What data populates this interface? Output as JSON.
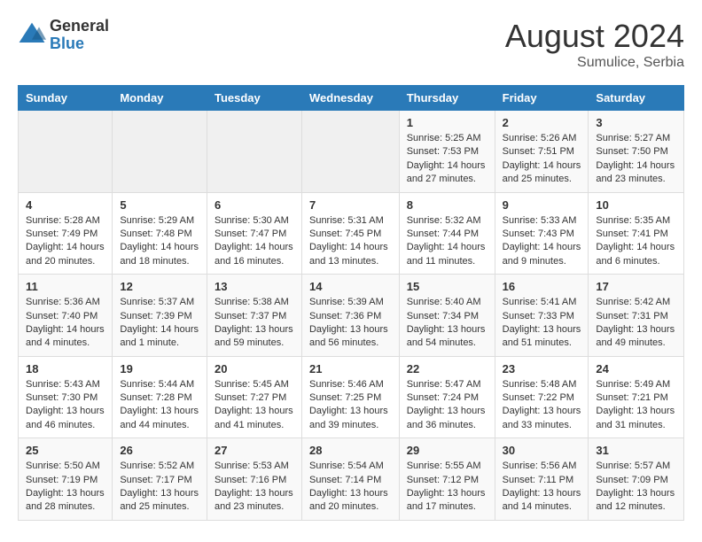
{
  "header": {
    "logo_general": "General",
    "logo_blue": "Blue",
    "month_year": "August 2024",
    "location": "Sumulice, Serbia"
  },
  "days_of_week": [
    "Sunday",
    "Monday",
    "Tuesday",
    "Wednesday",
    "Thursday",
    "Friday",
    "Saturday"
  ],
  "weeks": [
    [
      {
        "day": "",
        "content": ""
      },
      {
        "day": "",
        "content": ""
      },
      {
        "day": "",
        "content": ""
      },
      {
        "day": "",
        "content": ""
      },
      {
        "day": "1",
        "content": "Sunrise: 5:25 AM\nSunset: 7:53 PM\nDaylight: 14 hours and 27 minutes."
      },
      {
        "day": "2",
        "content": "Sunrise: 5:26 AM\nSunset: 7:51 PM\nDaylight: 14 hours and 25 minutes."
      },
      {
        "day": "3",
        "content": "Sunrise: 5:27 AM\nSunset: 7:50 PM\nDaylight: 14 hours and 23 minutes."
      }
    ],
    [
      {
        "day": "4",
        "content": "Sunrise: 5:28 AM\nSunset: 7:49 PM\nDaylight: 14 hours and 20 minutes."
      },
      {
        "day": "5",
        "content": "Sunrise: 5:29 AM\nSunset: 7:48 PM\nDaylight: 14 hours and 18 minutes."
      },
      {
        "day": "6",
        "content": "Sunrise: 5:30 AM\nSunset: 7:47 PM\nDaylight: 14 hours and 16 minutes."
      },
      {
        "day": "7",
        "content": "Sunrise: 5:31 AM\nSunset: 7:45 PM\nDaylight: 14 hours and 13 minutes."
      },
      {
        "day": "8",
        "content": "Sunrise: 5:32 AM\nSunset: 7:44 PM\nDaylight: 14 hours and 11 minutes."
      },
      {
        "day": "9",
        "content": "Sunrise: 5:33 AM\nSunset: 7:43 PM\nDaylight: 14 hours and 9 minutes."
      },
      {
        "day": "10",
        "content": "Sunrise: 5:35 AM\nSunset: 7:41 PM\nDaylight: 14 hours and 6 minutes."
      }
    ],
    [
      {
        "day": "11",
        "content": "Sunrise: 5:36 AM\nSunset: 7:40 PM\nDaylight: 14 hours and 4 minutes."
      },
      {
        "day": "12",
        "content": "Sunrise: 5:37 AM\nSunset: 7:39 PM\nDaylight: 14 hours and 1 minute."
      },
      {
        "day": "13",
        "content": "Sunrise: 5:38 AM\nSunset: 7:37 PM\nDaylight: 13 hours and 59 minutes."
      },
      {
        "day": "14",
        "content": "Sunrise: 5:39 AM\nSunset: 7:36 PM\nDaylight: 13 hours and 56 minutes."
      },
      {
        "day": "15",
        "content": "Sunrise: 5:40 AM\nSunset: 7:34 PM\nDaylight: 13 hours and 54 minutes."
      },
      {
        "day": "16",
        "content": "Sunrise: 5:41 AM\nSunset: 7:33 PM\nDaylight: 13 hours and 51 minutes."
      },
      {
        "day": "17",
        "content": "Sunrise: 5:42 AM\nSunset: 7:31 PM\nDaylight: 13 hours and 49 minutes."
      }
    ],
    [
      {
        "day": "18",
        "content": "Sunrise: 5:43 AM\nSunset: 7:30 PM\nDaylight: 13 hours and 46 minutes."
      },
      {
        "day": "19",
        "content": "Sunrise: 5:44 AM\nSunset: 7:28 PM\nDaylight: 13 hours and 44 minutes."
      },
      {
        "day": "20",
        "content": "Sunrise: 5:45 AM\nSunset: 7:27 PM\nDaylight: 13 hours and 41 minutes."
      },
      {
        "day": "21",
        "content": "Sunrise: 5:46 AM\nSunset: 7:25 PM\nDaylight: 13 hours and 39 minutes."
      },
      {
        "day": "22",
        "content": "Sunrise: 5:47 AM\nSunset: 7:24 PM\nDaylight: 13 hours and 36 minutes."
      },
      {
        "day": "23",
        "content": "Sunrise: 5:48 AM\nSunset: 7:22 PM\nDaylight: 13 hours and 33 minutes."
      },
      {
        "day": "24",
        "content": "Sunrise: 5:49 AM\nSunset: 7:21 PM\nDaylight: 13 hours and 31 minutes."
      }
    ],
    [
      {
        "day": "25",
        "content": "Sunrise: 5:50 AM\nSunset: 7:19 PM\nDaylight: 13 hours and 28 minutes."
      },
      {
        "day": "26",
        "content": "Sunrise: 5:52 AM\nSunset: 7:17 PM\nDaylight: 13 hours and 25 minutes."
      },
      {
        "day": "27",
        "content": "Sunrise: 5:53 AM\nSunset: 7:16 PM\nDaylight: 13 hours and 23 minutes."
      },
      {
        "day": "28",
        "content": "Sunrise: 5:54 AM\nSunset: 7:14 PM\nDaylight: 13 hours and 20 minutes."
      },
      {
        "day": "29",
        "content": "Sunrise: 5:55 AM\nSunset: 7:12 PM\nDaylight: 13 hours and 17 minutes."
      },
      {
        "day": "30",
        "content": "Sunrise: 5:56 AM\nSunset: 7:11 PM\nDaylight: 13 hours and 14 minutes."
      },
      {
        "day": "31",
        "content": "Sunrise: 5:57 AM\nSunset: 7:09 PM\nDaylight: 13 hours and 12 minutes."
      }
    ]
  ]
}
